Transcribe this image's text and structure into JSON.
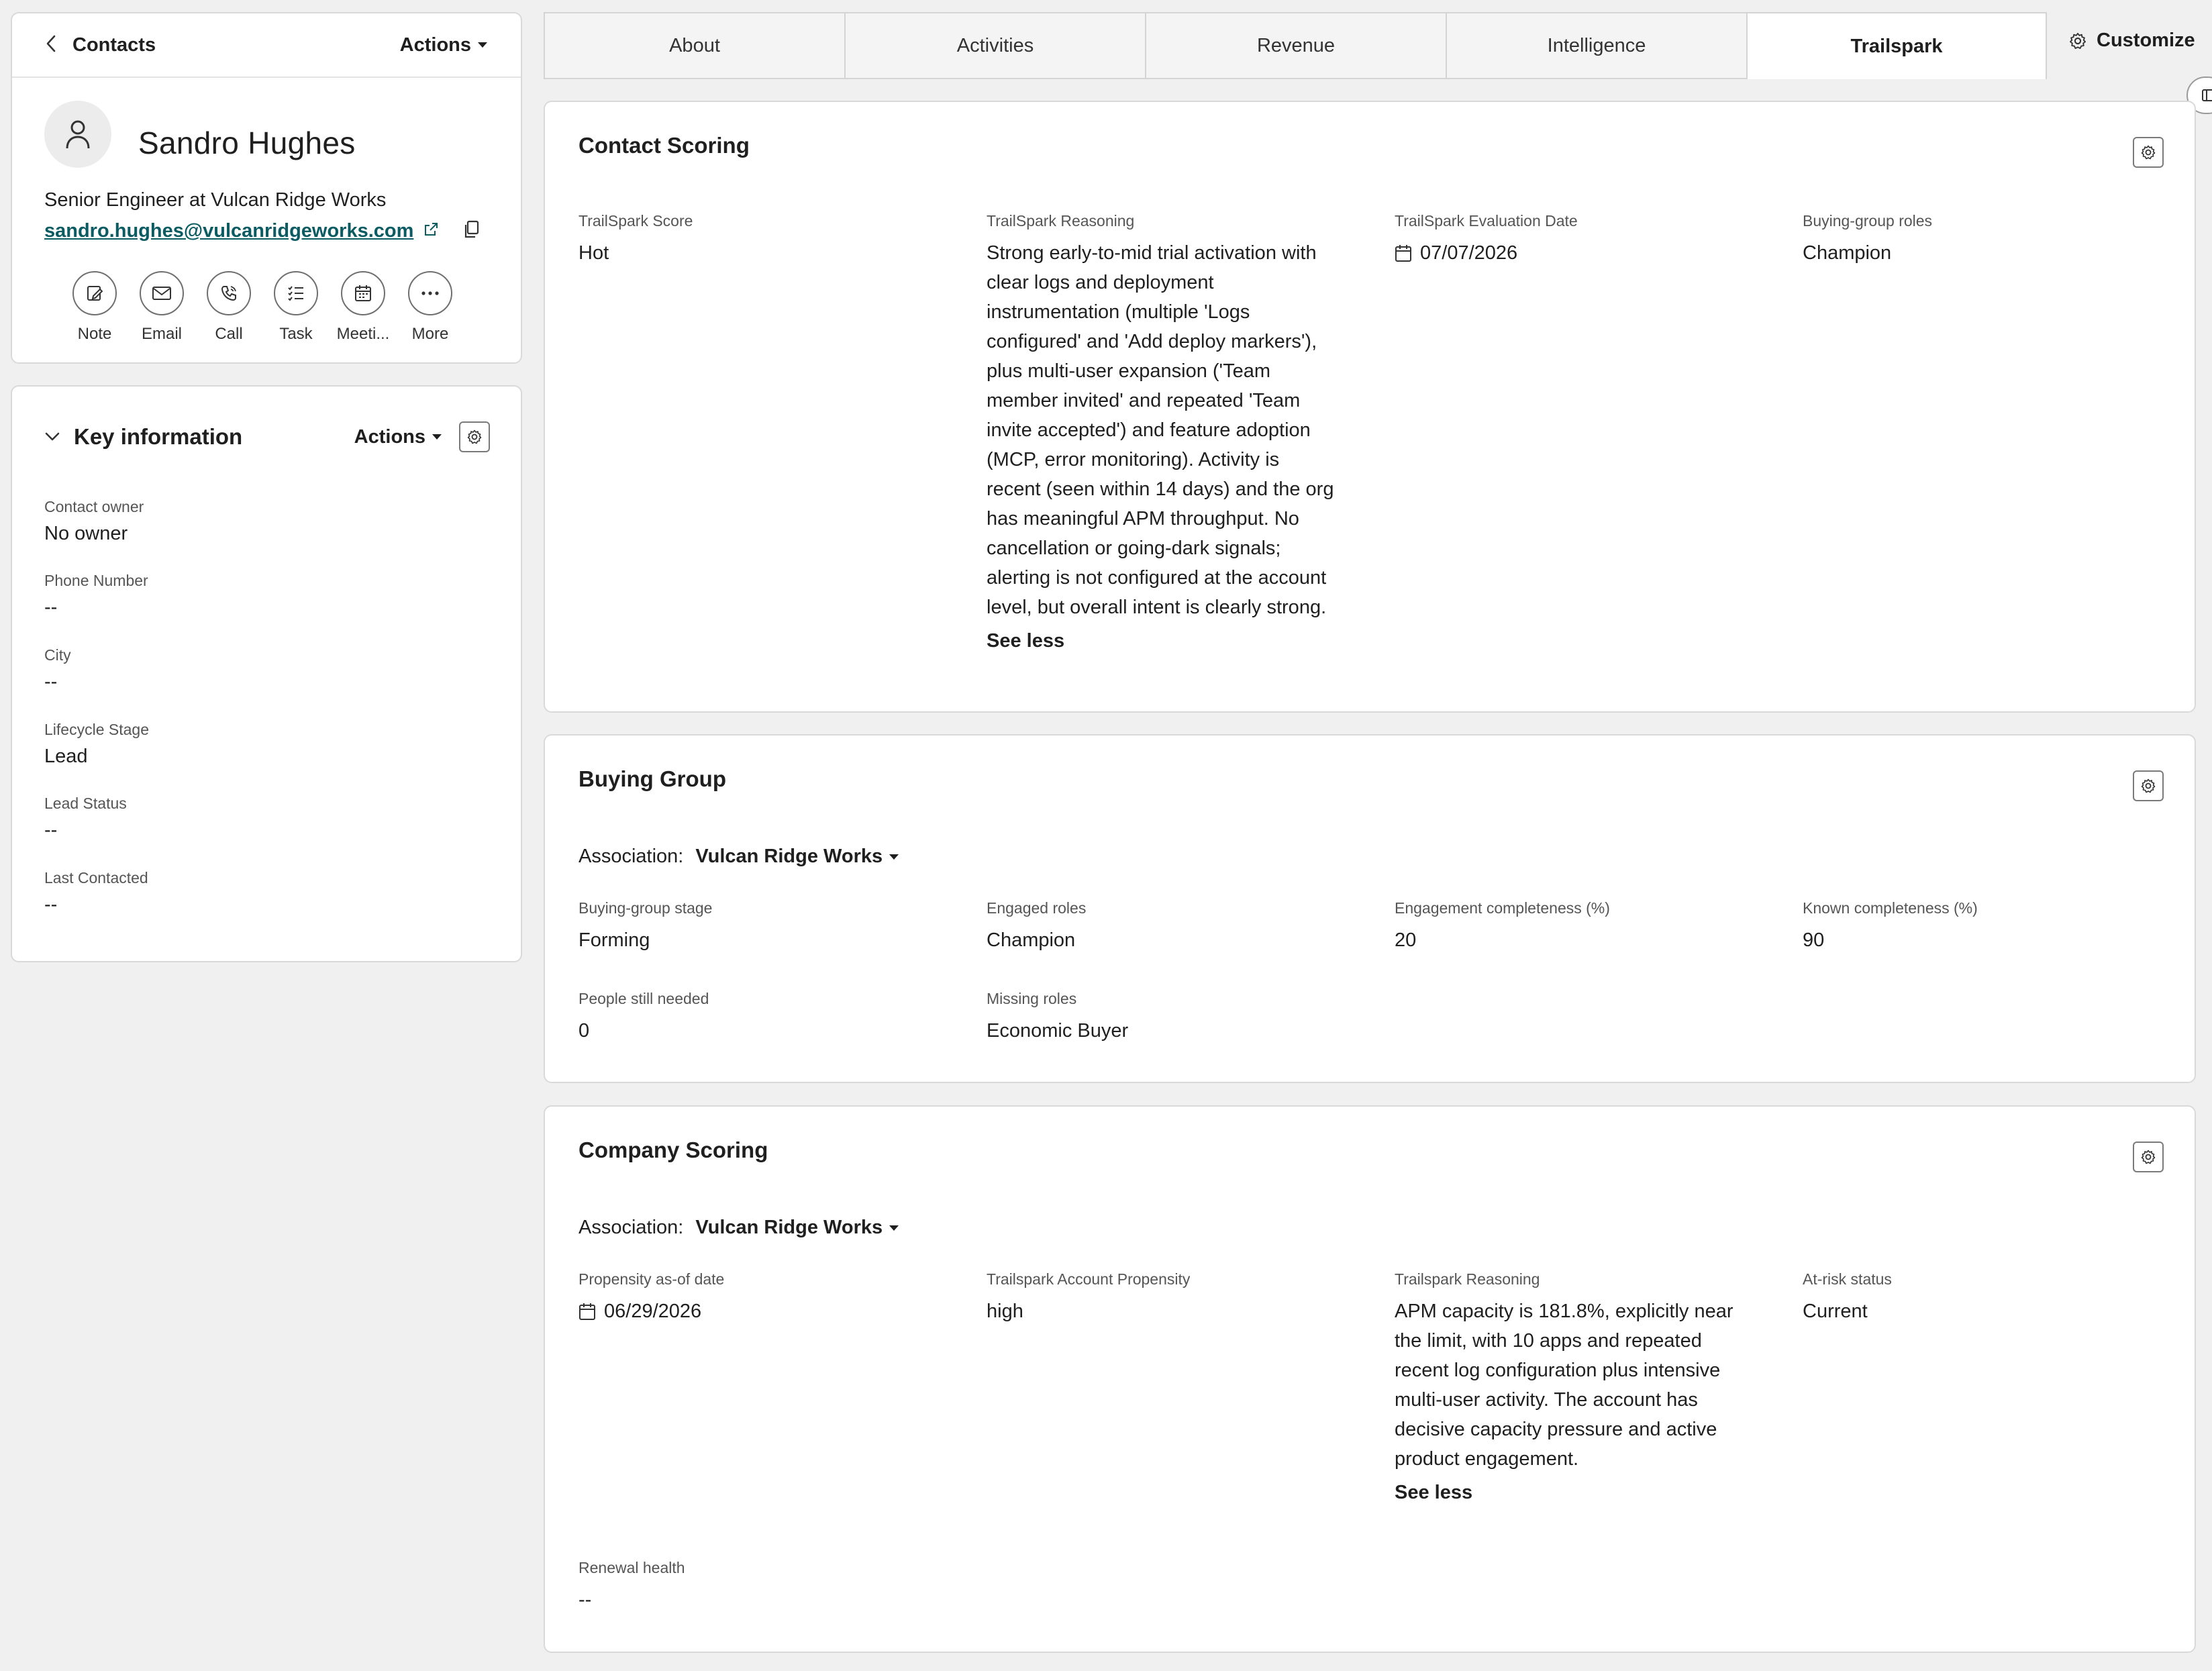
{
  "header": {
    "back_label": "Contacts",
    "actions_label": "Actions",
    "name": "Sandro Hughes",
    "job_title": "Senior Engineer at Vulcan Ridge Works",
    "email": "sandro.hughes@vulcanridgeworks.com",
    "quick_actions": [
      {
        "label": "Note",
        "icon": "note-icon"
      },
      {
        "label": "Email",
        "icon": "email-icon"
      },
      {
        "label": "Call",
        "icon": "call-icon"
      },
      {
        "label": "Task",
        "icon": "task-icon"
      },
      {
        "label": "Meeti...",
        "icon": "meeting-icon"
      },
      {
        "label": "More",
        "icon": "more-icon"
      }
    ]
  },
  "key_info": {
    "title": "Key information",
    "actions_label": "Actions",
    "fields": [
      {
        "label": "Contact owner",
        "value": "No owner"
      },
      {
        "label": "Phone Number",
        "value": "--"
      },
      {
        "label": "City",
        "value": "--"
      },
      {
        "label": "Lifecycle Stage",
        "value": "Lead"
      },
      {
        "label": "Lead Status",
        "value": "--"
      },
      {
        "label": "Last Contacted",
        "value": "--"
      }
    ]
  },
  "tabs": [
    {
      "label": "About",
      "active": false
    },
    {
      "label": "Activities",
      "active": false
    },
    {
      "label": "Revenue",
      "active": false
    },
    {
      "label": "Intelligence",
      "active": false
    },
    {
      "label": "Trailspark",
      "active": true
    }
  ],
  "customize_label": "Customize",
  "contact_scoring": {
    "title": "Contact Scoring",
    "score_label": "TrailSpark Score",
    "score_value": "Hot",
    "reasoning_label": "TrailSpark Reasoning",
    "reasoning_lines": [
      "Strong early-to-mid trial activation with",
      "clear logs and deployment",
      "instrumentation (multiple 'Logs",
      "configured' and 'Add deploy markers'),",
      "plus multi-user expansion ('Team",
      "member invited' and repeated 'Team",
      "invite accepted') and feature adoption",
      "(MCP, error monitoring). Activity is",
      "recent (seen within 14 days) and the org",
      "has meaningful APM throughput. No",
      "cancellation or going-dark signals;",
      "alerting is not configured at the account",
      "level, but overall intent is clearly strong."
    ],
    "see_less": "See less",
    "eval_date_label": "TrailSpark Evaluation Date",
    "eval_date_value": "07/07/2026",
    "roles_label": "Buying-group roles",
    "roles_value": "Champion"
  },
  "buying_group": {
    "title": "Buying Group",
    "association_label": "Association:",
    "association_value": "Vulcan Ridge Works",
    "stage_label": "Buying-group stage",
    "stage_value": "Forming",
    "engaged_label": "Engaged roles",
    "engaged_value": "Champion",
    "engagement_label": "Engagement completeness (%)",
    "engagement_value": "20",
    "known_label": "Known completeness (%)",
    "known_value": "90",
    "people_label": "People still needed",
    "people_value": "0",
    "missing_label": "Missing roles",
    "missing_value": "Economic Buyer"
  },
  "company_scoring": {
    "title": "Company Scoring",
    "association_label": "Association:",
    "association_value": "Vulcan Ridge Works",
    "propensity_date_label": "Propensity as-of date",
    "propensity_date_value": "06/29/2026",
    "account_propensity_label": "Trailspark Account Propensity",
    "account_propensity_value": "high",
    "reasoning_label": "Trailspark Reasoning",
    "reasoning_lines": [
      "APM capacity is 181.8%, explicitly near",
      "the limit, with 10 apps and repeated",
      "recent log configuration plus intensive",
      "multi-user activity. The account has",
      "decisive capacity pressure and active",
      "product engagement."
    ],
    "see_less": "See less",
    "at_risk_label": "At-risk status",
    "at_risk_value": "Current",
    "renewal_label": "Renewal health",
    "renewal_value": "--"
  },
  "colors": {
    "email_link": "#0b5b63",
    "background": "#f0f0f0",
    "card": "#ffffff",
    "border": "#d9d9d9"
  }
}
